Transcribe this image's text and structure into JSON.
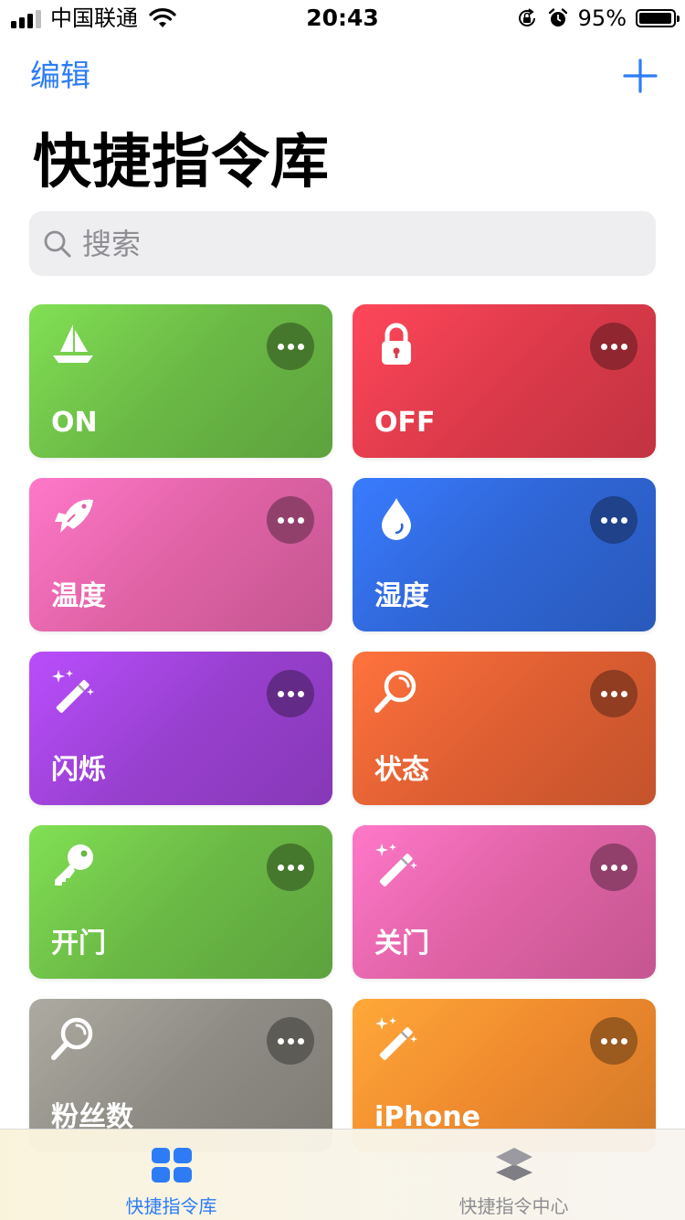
{
  "status_bar": {
    "carrier": "中国联通",
    "time": "20:43",
    "battery": "95%"
  },
  "nav": {
    "edit_label": "编辑",
    "add_icon": "plus-icon"
  },
  "title": "快捷指令库",
  "search": {
    "placeholder": "搜索"
  },
  "colors": {
    "accent": "#2d7cf6",
    "tab_active": "#2d7cf6",
    "tab_inactive": "#8e8e93"
  },
  "shortcuts": [
    {
      "label": "ON",
      "icon": "sailboat-icon",
      "color": "#6ab845"
    },
    {
      "label": "OFF",
      "icon": "lock-icon",
      "color": "#dc3a4a"
    },
    {
      "label": "温度",
      "icon": "fish-icon",
      "color": "#df62a5"
    },
    {
      "label": "湿度",
      "icon": "water-drop-icon",
      "color": "#2f65d4"
    },
    {
      "label": "闪烁",
      "icon": "magic-wand-icon",
      "color": "#9840cf"
    },
    {
      "label": "状态",
      "icon": "magnifier-icon",
      "color": "#de5e32"
    },
    {
      "label": "开门",
      "icon": "key-icon",
      "color": "#6ab845"
    },
    {
      "label": "关门",
      "icon": "magic-wand-icon",
      "color": "#df62a5"
    },
    {
      "label": "粉丝数",
      "icon": "magnifier-icon",
      "color": "#8e8c84"
    },
    {
      "label": "iPhone",
      "icon": "magic-wand-icon",
      "color": "#ef8a2e"
    }
  ],
  "tabs": [
    {
      "label": "快捷指令库",
      "icon": "grid-icon",
      "active": true
    },
    {
      "label": "快捷指令中心",
      "icon": "layers-icon",
      "active": false
    }
  ]
}
